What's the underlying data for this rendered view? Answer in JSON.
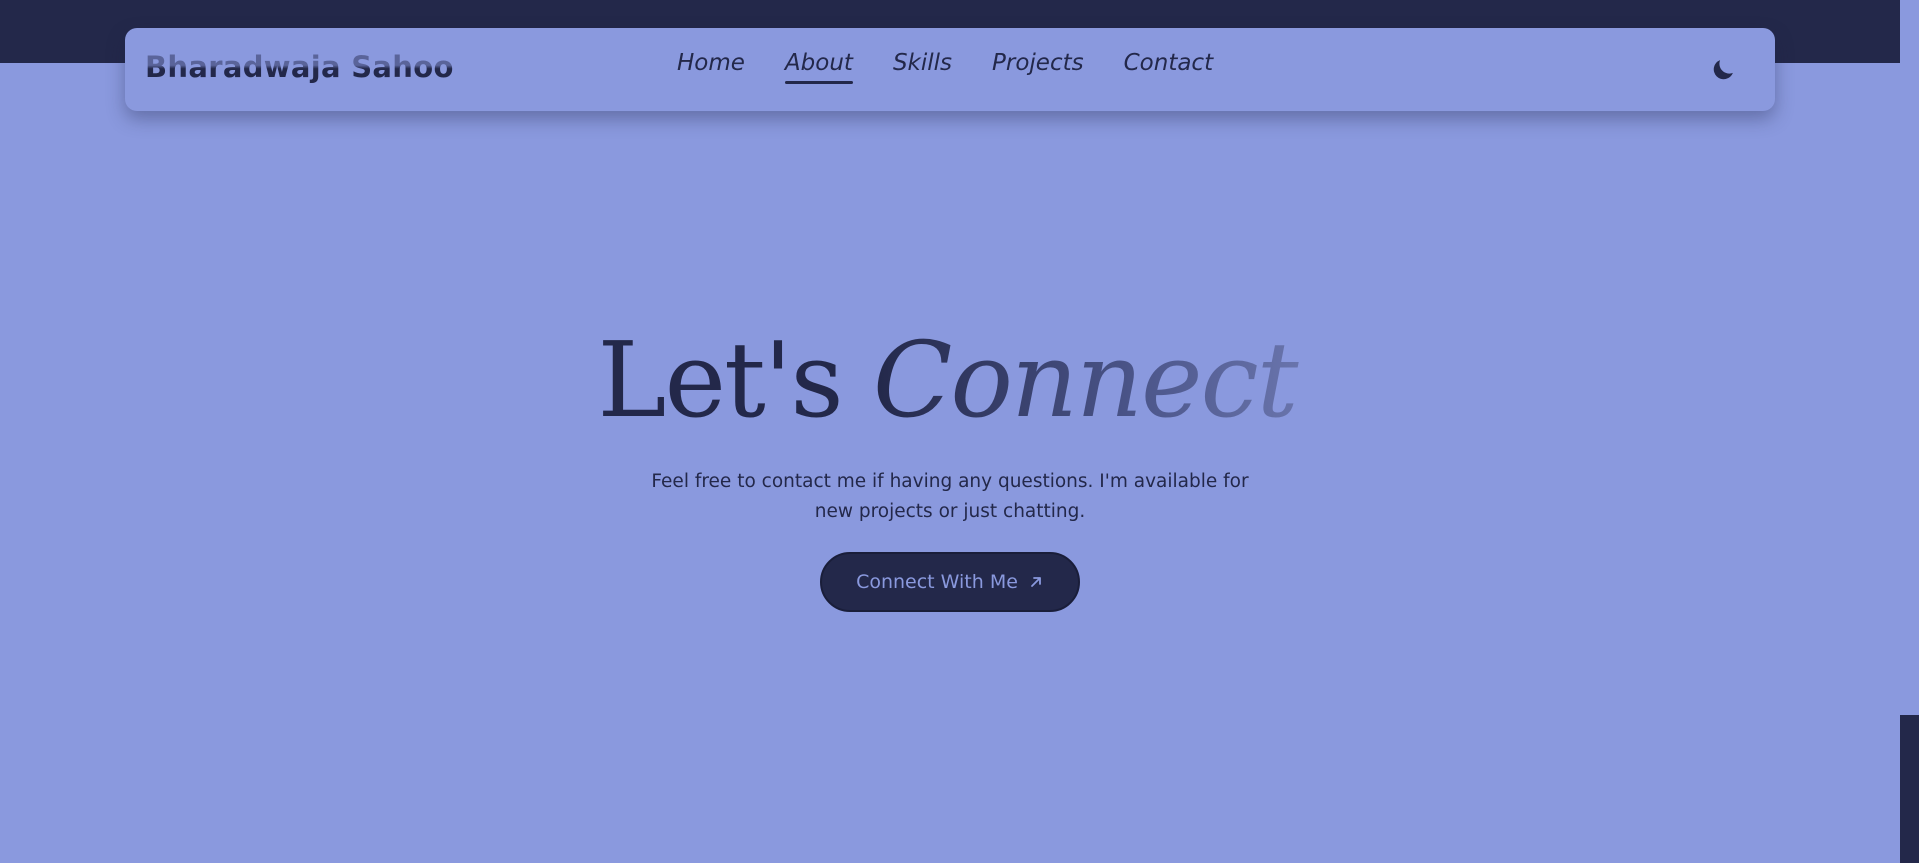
{
  "brand": {
    "name": "Bharadwaja Sahoo"
  },
  "nav": {
    "items": [
      {
        "label": "Home",
        "active": false
      },
      {
        "label": "About",
        "active": true
      },
      {
        "label": "Skills",
        "active": false
      },
      {
        "label": "Projects",
        "active": false
      },
      {
        "label": "Contact",
        "active": false
      }
    ],
    "theme_toggle_icon": "moon-icon"
  },
  "hero": {
    "title_plain": "Let's",
    "title_accent": "Connect",
    "subtitle": "Feel free to contact me if having any questions. I'm available for new projects or just chatting.",
    "cta_label": "Connect With Me",
    "cta_icon": "arrow-up-right-icon"
  },
  "colors": {
    "background": "#8a99de",
    "dark": "#23284a",
    "accent_gradient_end": "#6a75ad"
  }
}
